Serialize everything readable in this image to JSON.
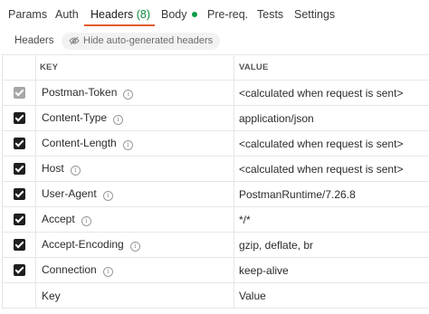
{
  "tabs": [
    {
      "label": "Params"
    },
    {
      "label": "Auth"
    },
    {
      "label": "Headers",
      "count": "(8)"
    },
    {
      "label": "Body"
    },
    {
      "label": "Pre-req."
    },
    {
      "label": "Tests"
    },
    {
      "label": "Settings"
    }
  ],
  "colors": {
    "active_underline": "#e35a2b",
    "body_dot": "#0b9e4a",
    "count": "#0f8a3c"
  },
  "subbar": {
    "label": "Headers",
    "hide_button": "Hide auto-generated headers"
  },
  "table": {
    "columns": [
      "KEY",
      "VALUE"
    ],
    "rows": [
      {
        "key": "Postman-Token",
        "value": "<calculated when request is sent>"
      },
      {
        "key": "Content-Type",
        "value": "application/json"
      },
      {
        "key": "Content-Length",
        "value": "<calculated when request is sent>"
      },
      {
        "key": "Host",
        "value": "<calculated when request is sent>"
      },
      {
        "key": "User-Agent",
        "value": "PostmanRuntime/7.26.8"
      },
      {
        "key": "Accept",
        "value": "*/*"
      },
      {
        "key": "Accept-Encoding",
        "value": "gzip, deflate, br"
      },
      {
        "key": "Connection",
        "value": "keep-alive"
      }
    ],
    "new_row": {
      "key_placeholder": "Key",
      "value_placeholder": "Value"
    }
  }
}
